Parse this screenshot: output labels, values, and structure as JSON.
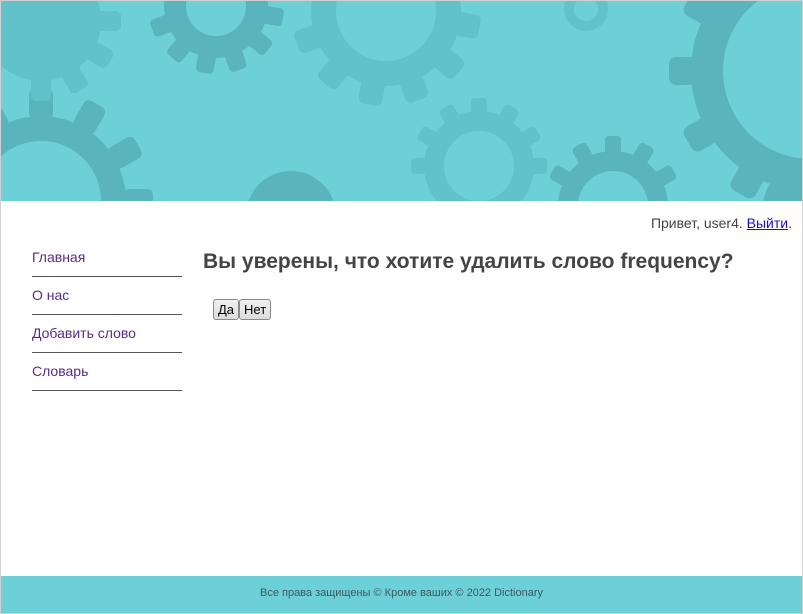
{
  "header": {
    "banner_color": "#6dd0d9",
    "gear_color": "#5ab4bd",
    "gear_light_color": "#62c2cb"
  },
  "user_bar": {
    "greeting": "Привет, user4.",
    "logout_label": "Выйти",
    "trailing": "."
  },
  "sidebar": {
    "items": [
      {
        "label": "Главная"
      },
      {
        "label": "О нас"
      },
      {
        "label": "Добавить слово"
      },
      {
        "label": "Словарь"
      }
    ]
  },
  "main": {
    "title": "Вы уверены, что хотите удалить слово frequency?",
    "yes_label": "Да",
    "no_label": "Нет"
  },
  "footer": {
    "text": "Все права защищены © Кроме ваших © 2022 Dictionary",
    "color": "#6dd0d9"
  }
}
